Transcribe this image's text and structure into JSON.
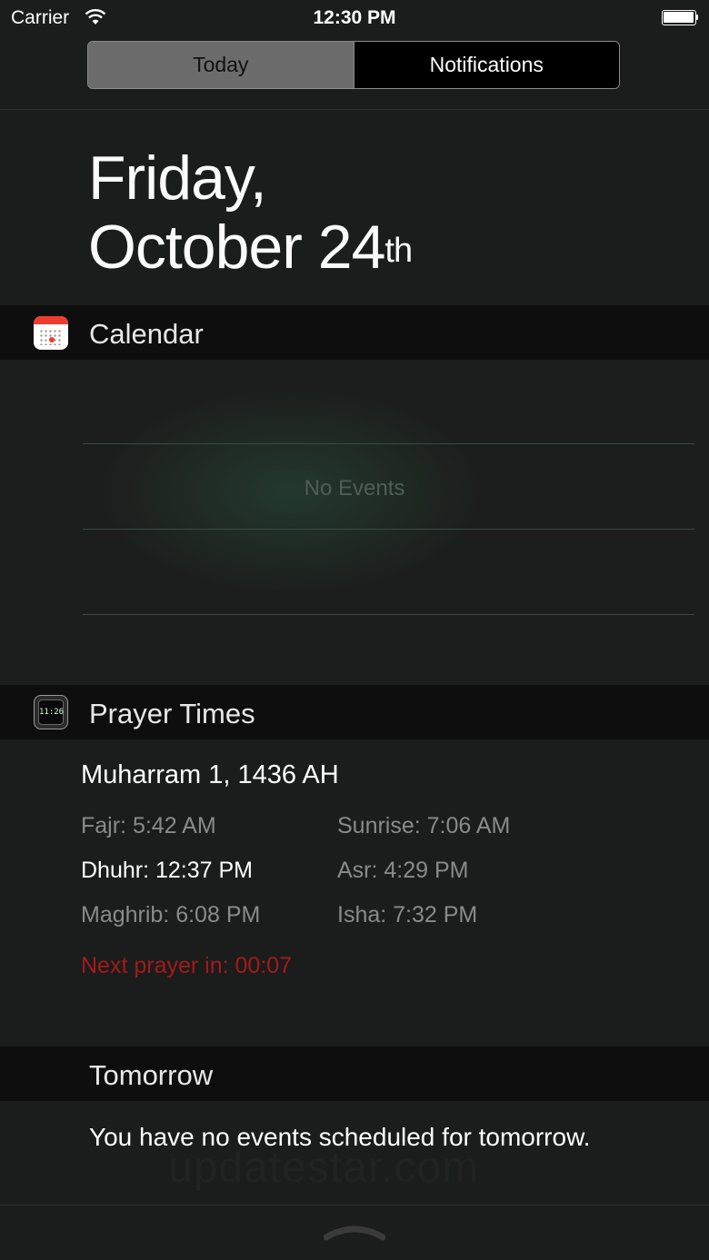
{
  "status_bar": {
    "carrier": "Carrier",
    "time": "12:30 PM"
  },
  "tabs": [
    {
      "label": "Today",
      "selected": true
    },
    {
      "label": "Notifications",
      "selected": false
    }
  ],
  "date": {
    "line1": "Friday,",
    "line2": "October 24",
    "suffix": "th"
  },
  "calendar": {
    "title": "Calendar",
    "icon": "calendar-app-icon",
    "empty_text": "No Events"
  },
  "prayer_times": {
    "title": "Prayer Times",
    "icon": "prayer-times-app-icon",
    "icon_clock": "11:26",
    "hijri_date": "Muharram 1, 1436 AH",
    "items": [
      {
        "text": "Fajr: 5:42 AM",
        "current": false
      },
      {
        "text": "Sunrise: 7:06 AM",
        "current": false
      },
      {
        "text": "Dhuhr: 12:37 PM",
        "current": true
      },
      {
        "text": "Asr: 4:29 PM",
        "current": false
      },
      {
        "text": "Maghrib: 6:08 PM",
        "current": false
      },
      {
        "text": "Isha: 7:32 PM",
        "current": false
      }
    ],
    "next_prayer": "Next prayer in: 00:07",
    "next_color": "#a41a1a"
  },
  "tomorrow": {
    "title": "Tomorrow",
    "text": "You have no events scheduled for tomorrow."
  },
  "watermark": "updatestar.com",
  "colors": {
    "background": "#1b1c1c",
    "header": "#0e0e0e",
    "calendar_red": "#f03b30"
  }
}
